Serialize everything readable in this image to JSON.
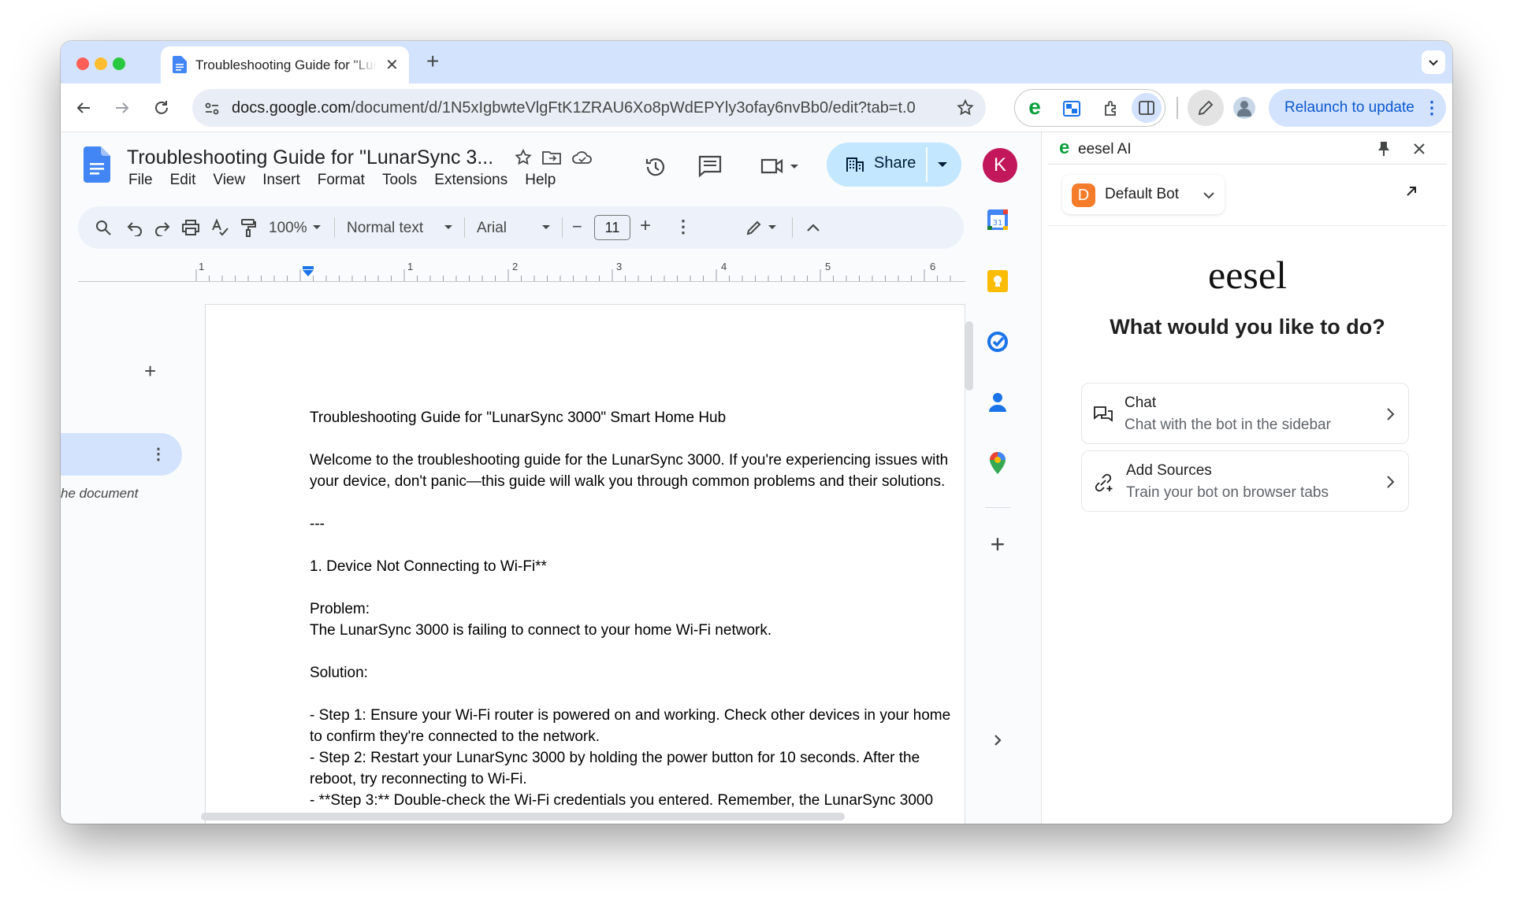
{
  "browser": {
    "tab_title": "Troubleshooting Guide for \"LunarSync 3000\" Smart Home Hub",
    "url_host": "docs.google.com",
    "url_path": "/document/d/1N5xIgbwteVlgFtK1ZRAU6Xo8pWdEPYly3ofay6nvBb0/edit?tab=t.0",
    "relaunch_label": "Relaunch to update",
    "colors": {
      "tabstrip": "#d3e3fd",
      "close": "#ff5f57",
      "minimize": "#febc2e",
      "zoom": "#28c840"
    }
  },
  "docs": {
    "title": "Troubleshooting Guide for \"LunarSync 3...",
    "menu": [
      "File",
      "Edit",
      "View",
      "Insert",
      "Format",
      "Tools",
      "Extensions",
      "Help"
    ],
    "share_label": "Share",
    "avatar_letter": "K",
    "toolbar": {
      "zoom": "100%",
      "style": "Normal text",
      "font": "Arial",
      "font_size": "11"
    },
    "ruler_numbers": [
      "1",
      "1",
      "2",
      "3",
      "4",
      "5",
      "6"
    ],
    "outline_hint": "he document",
    "body": [
      "Troubleshooting Guide for \"LunarSync 3000\" Smart Home Hub",
      "",
      "Welcome to the troubleshooting guide for the LunarSync 3000. If you're experiencing issues with your device, don't panic—this guide will walk you through common problems and their solutions.",
      "",
      "---",
      "",
      "1. Device Not Connecting to Wi-Fi**",
      "",
      "Problem:",
      "The LunarSync 3000 is failing to connect to your home Wi-Fi network.",
      "",
      "Solution:",
      "",
      "- Step 1: Ensure your Wi-Fi router is powered on and working. Check other devices in your home to confirm they're connected to the network.",
      "- Step 2: Restart your LunarSync 3000 by holding the power button for 10 seconds. After the reboot, try reconnecting to Wi-Fi.",
      "- **Step 3:** Double-check the Wi-Fi credentials you entered. Remember, the LunarSync 3000"
    ]
  },
  "eesel": {
    "header_title": "eesel AI",
    "bot_initial": "D",
    "bot_name": "Default Bot",
    "logo": "eesel",
    "heading": "What would you like to do?",
    "cards": [
      {
        "title": "Chat",
        "subtitle": "Chat with the bot in the sidebar",
        "icon": "chat-bubbles-icon"
      },
      {
        "title": "Add Sources",
        "subtitle": "Train your bot on browser tabs",
        "icon": "link-plus-icon"
      }
    ],
    "colors": {
      "accent": "#0b9e3c",
      "bot_badge": "#f57c2b"
    }
  }
}
